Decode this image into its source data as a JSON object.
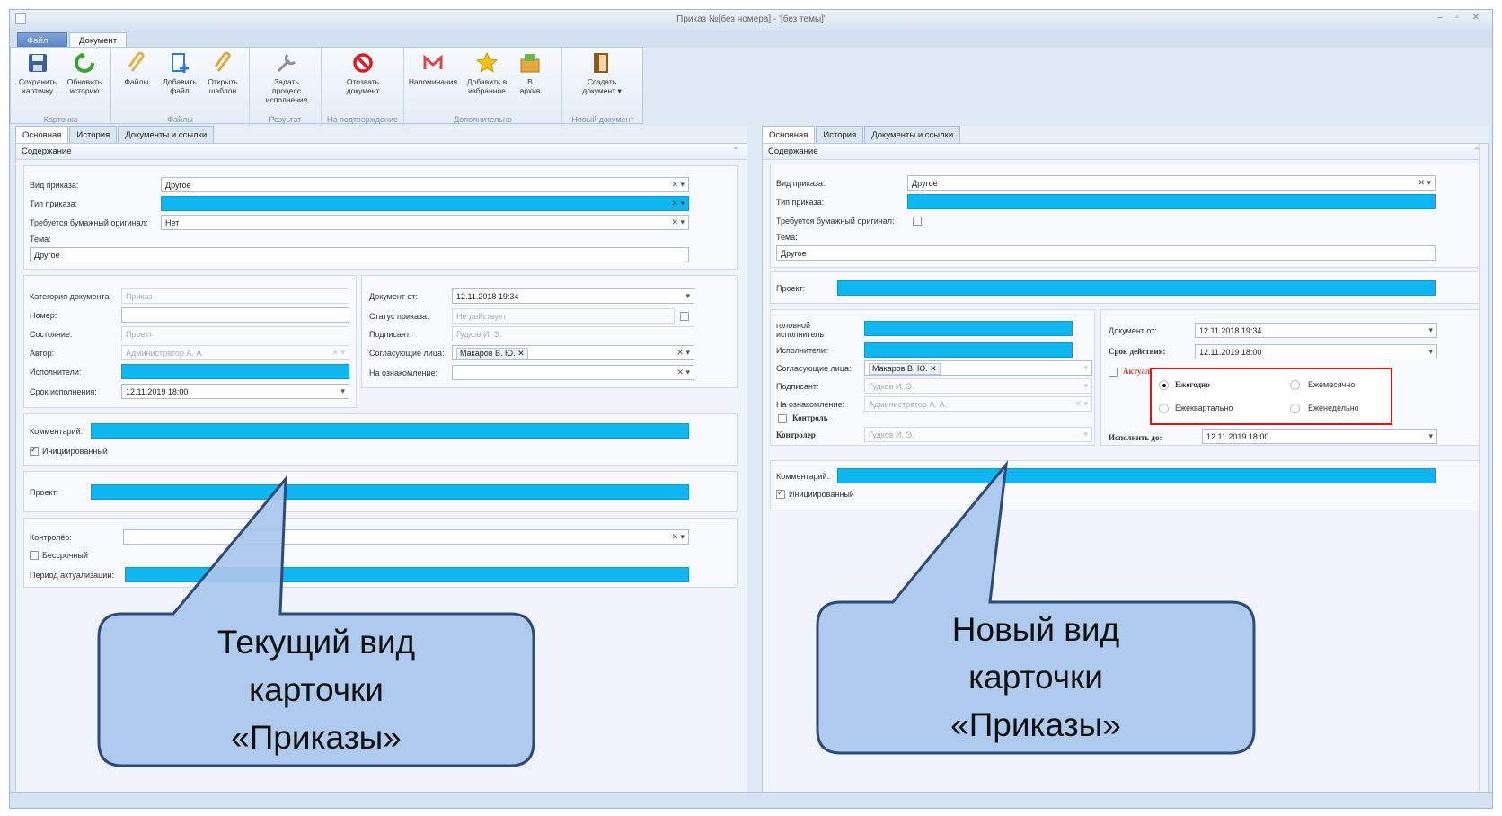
{
  "window": {
    "title": "Приказ №[без номера] - '[без темы]'",
    "controls": "– ▫ ✕"
  },
  "app_tabs": {
    "file": "Файл",
    "document": "Документ"
  },
  "ribbon": {
    "groups": [
      {
        "label": "Карточка",
        "buttons": [
          {
            "line1": "Сохранить",
            "line2": "карточку"
          },
          {
            "line1": "Обновить",
            "line2": "историю"
          }
        ]
      },
      {
        "label": "Файлы",
        "buttons": [
          {
            "line1": "Файлы",
            "line2": ""
          },
          {
            "line1": "Добавить",
            "line2": "файл"
          },
          {
            "line1": "Открыть",
            "line2": "шаблон"
          }
        ]
      },
      {
        "label": "Резуьтат",
        "buttons": [
          {
            "line1": "Задать процесс",
            "line2": "исполнения"
          }
        ]
      },
      {
        "label": "На подтверждение",
        "buttons": [
          {
            "line1": "Отозвать",
            "line2": "документ"
          }
        ]
      },
      {
        "label": "Дополнительно",
        "buttons": [
          {
            "line1": "Напоминания",
            "line2": ""
          },
          {
            "line1": "Добавить в",
            "line2": "избранное"
          },
          {
            "line1": "В",
            "line2": "архив"
          }
        ]
      },
      {
        "label": "Новый документ",
        "buttons": [
          {
            "line1": "Создать",
            "line2": "документ ▾"
          }
        ]
      }
    ]
  },
  "doc_tabs": [
    "Основная",
    "История",
    "Документы и ссылки"
  ],
  "section_title": "Содержание",
  "left": {
    "order_type_label": "Вид приказа:",
    "order_type_value": "Другое",
    "order_kind_label": "Тип приказа:",
    "paper_original_label": "Требуется бумажный оригинал:",
    "paper_original_value": "Нет",
    "topic_label": "Тема:",
    "topic_value": "Другое",
    "category_label": "Категория документа:",
    "category_value": "Приказ",
    "number_label": "Номер:",
    "state_label": "Состояние:",
    "state_value": "Проект",
    "author_label": "Автор:",
    "author_value": "Администратор А. А.",
    "executors_label": "Исполнители:",
    "due_label": "Срок исполнения:",
    "due_value": "12.11.2019 18:00",
    "doc_from_label": "Документ от:",
    "doc_from_value": "12.11.2018 19:34",
    "order_status_label": "Статус приказа:",
    "order_status_value": "Не действует",
    "signer_label": "Подписант:",
    "signer_value": "Гудков И. Э.",
    "approvers_label": "Согласующие лица:",
    "approvers_value": "Макаров В. Ю.",
    "familiarize_label": "На ознакомление:",
    "comment_label": "Комментарий:",
    "initiated_label": "Инициированный",
    "project_label": "Проект:",
    "controller_label": "Контролёр:",
    "indefinite_label": "Бессрочный",
    "update_period_label": "Период актуализации:"
  },
  "right": {
    "order_type_label": "Вид приказа:",
    "order_type_value": "Другое",
    "order_kind_label": "Тип приказа:",
    "paper_original_label": "Требуется бумажный оригинал:",
    "topic_label": "Тема:",
    "topic_value": "Другое",
    "project_label": "Проект:",
    "head_executor_label": "головной исполнитель",
    "executors_label": "Исполнители:",
    "approvers_label": "Согласующие лица:",
    "approvers_value": "Макаров В. Ю.",
    "signer_label": "Подписант:",
    "signer_value": "Гудков И. Э.",
    "familiarize_label": "На ознакомление:",
    "familiarize_value": "Администратор А. А.",
    "control_label": "Контроль",
    "controller_label": "Контролер",
    "controller_value": "Гудков И. Э.",
    "doc_from_label": "Документ от:",
    "doc_from_value": "12.11.2018 19:34",
    "validity_label": "Срок действия:",
    "validity_value": "12.11.2019 18:00",
    "actualization_label": "Актуализация",
    "periods": [
      "Ежегодно",
      "Ежемесячно",
      "Ежеквартально",
      "Еженедельно"
    ],
    "execute_until_label": "Исполнить до:",
    "execute_until_value": "12.11.2019 18:00",
    "comment_label": "Комментарий:",
    "initiated_label": "Инициированный"
  },
  "callouts": {
    "left": [
      "Текущий вид",
      "карточки",
      "«Приказы»"
    ],
    "right": [
      "Новый вид",
      "карточки",
      "«Приказы»"
    ]
  },
  "colors": {
    "highlight": "#10b6f0",
    "callout_fill": "#a9c6ec",
    "callout_border": "#2e4a78",
    "red_frame": "#e01414"
  }
}
